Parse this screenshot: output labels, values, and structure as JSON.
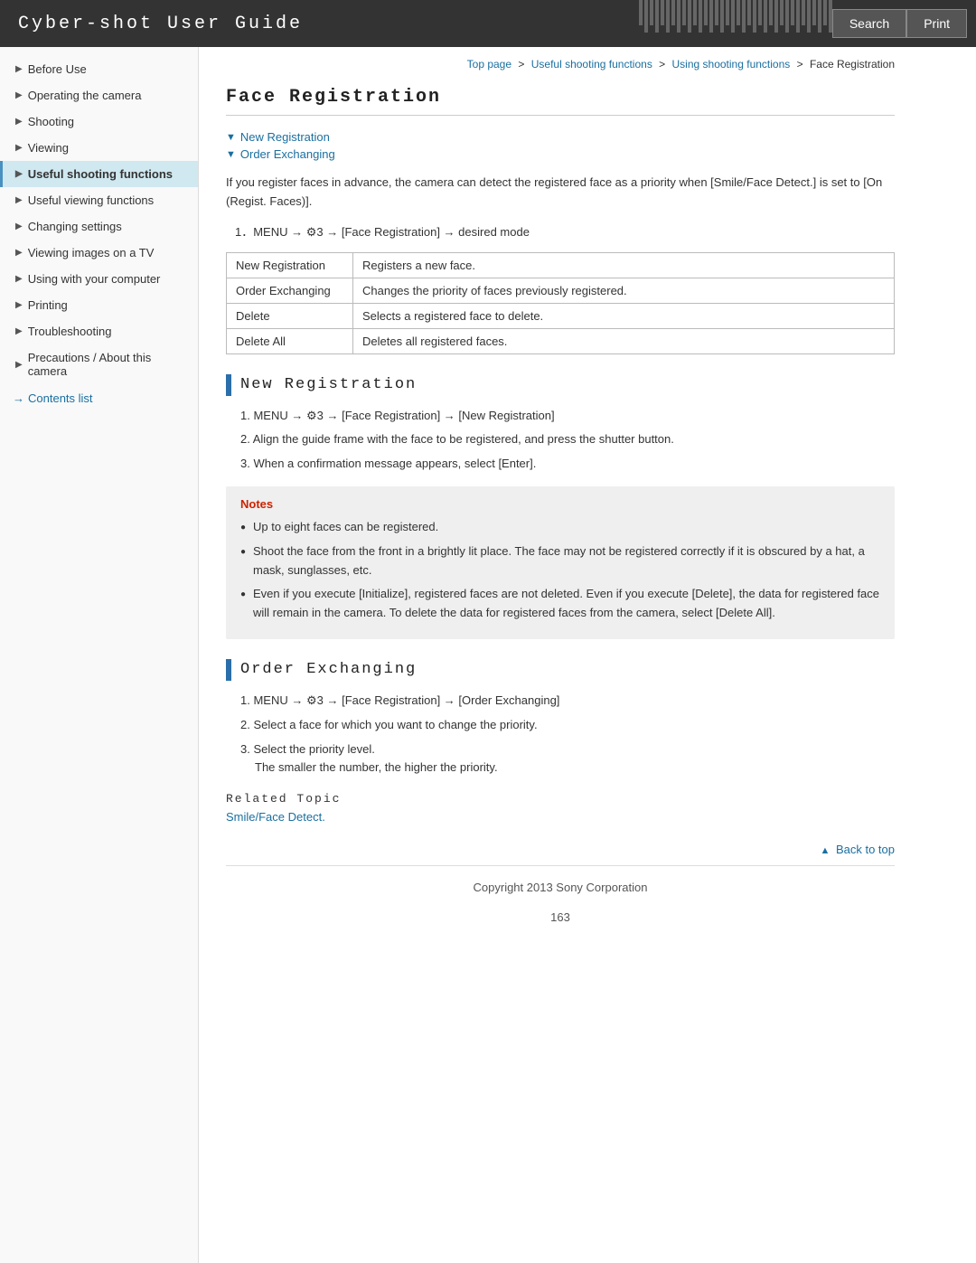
{
  "header": {
    "title": "Cyber-shot User Guide",
    "search_label": "Search",
    "print_label": "Print"
  },
  "breadcrumb": {
    "items": [
      {
        "text": "Top page",
        "link": true
      },
      {
        "text": "Useful shooting functions",
        "link": true
      },
      {
        "text": "Using shooting functions",
        "link": true
      },
      {
        "text": "Face Registration",
        "link": false
      }
    ]
  },
  "page_title": "Face Registration",
  "section_links": [
    {
      "text": "New Registration"
    },
    {
      "text": "Order Exchanging"
    }
  ],
  "intro": {
    "text": "If you register faces in advance, the camera can detect the registered face as a priority when [Smile/Face Detect.] is set to [On (Regist. Faces)]."
  },
  "menu_step1": "1．MENU → ⚙3 → [Face Registration] → desired mode",
  "table": {
    "rows": [
      {
        "col1": "New Registration",
        "col2": "Registers a new face."
      },
      {
        "col1": "Order Exchanging",
        "col2": "Changes the priority of faces previously registered."
      },
      {
        "col1": "Delete",
        "col2": "Selects a registered face to delete."
      },
      {
        "col1": "Delete All",
        "col2": "Deletes all registered faces."
      }
    ]
  },
  "new_registration": {
    "heading": "New Registration",
    "steps": [
      "MENU → ⚙3 → [Face Registration] → [New Registration]",
      "Align the guide frame with the face to be registered, and press the shutter button.",
      "When a confirmation message appears, select [Enter]."
    ],
    "notes_title": "Notes",
    "notes": [
      "Up to eight faces can be registered.",
      "Shoot the face from the front in a brightly lit place. The face may not be registered correctly if it is obscured by a hat, a mask, sunglasses, etc.",
      "Even if you execute [Initialize], registered faces are not deleted. Even if you execute [Delete], the data for registered face will remain in the camera. To delete the data for registered faces from the camera, select [Delete All]."
    ]
  },
  "order_exchanging": {
    "heading": "Order Exchanging",
    "steps": [
      "MENU → ⚙3 → [Face Registration] → [Order Exchanging]",
      "Select a face for which you want to change the priority.",
      "Select the priority level.\nThe smaller the number, the higher the priority."
    ]
  },
  "related_topic": {
    "title": "Related Topic",
    "link_text": "Smile/Face Detect."
  },
  "back_to_top": "Back to top",
  "footer": {
    "copyright": "Copyright 2013 Sony Corporation",
    "page_number": "163"
  },
  "sidebar": {
    "items": [
      {
        "label": "Before Use",
        "active": false
      },
      {
        "label": "Operating the camera",
        "active": false
      },
      {
        "label": "Shooting",
        "active": false
      },
      {
        "label": "Viewing",
        "active": false
      },
      {
        "label": "Useful shooting functions",
        "active": true
      },
      {
        "label": "Useful viewing functions",
        "active": false
      },
      {
        "label": "Changing settings",
        "active": false
      },
      {
        "label": "Viewing images on a TV",
        "active": false
      },
      {
        "label": "Using with your computer",
        "active": false
      },
      {
        "label": "Printing",
        "active": false
      },
      {
        "label": "Troubleshooting",
        "active": false
      },
      {
        "label": "Precautions / About this camera",
        "active": false
      }
    ],
    "contents_link": "Contents list"
  }
}
